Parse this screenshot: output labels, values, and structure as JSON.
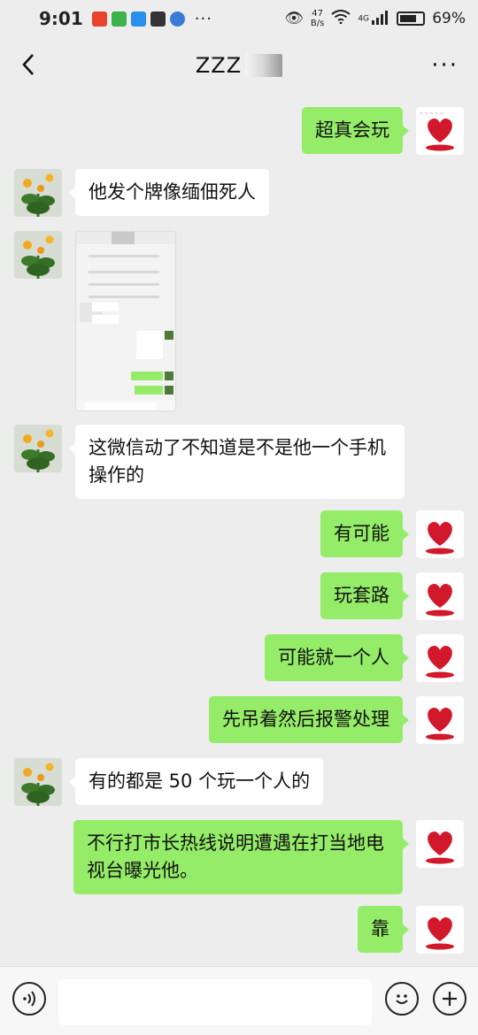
{
  "status": {
    "time": "9:01",
    "speed_value": "47",
    "speed_unit": "B/s",
    "network": "4G",
    "battery": "69%"
  },
  "header": {
    "title": "ZZZ"
  },
  "messages": [
    {
      "side": "out",
      "text": "超真会玩"
    },
    {
      "side": "in",
      "text": "他发个牌像缅佃死人"
    },
    {
      "side": "in",
      "type": "image"
    },
    {
      "side": "in",
      "text": "这微信动了不知道是不是他一个手机操作的"
    },
    {
      "side": "out",
      "text": "有可能"
    },
    {
      "side": "out",
      "text": "玩套路"
    },
    {
      "side": "out",
      "text": "可能就一个人"
    },
    {
      "side": "out",
      "text": "先吊着然后报警处理"
    },
    {
      "side": "in",
      "text": "有的都是 50 个玩一个人的"
    },
    {
      "side": "out",
      "text": "不行打市长热线说明遭遇在打当地电视台曝光他。"
    },
    {
      "side": "out",
      "text": "靠"
    }
  ],
  "colors": {
    "outgoing_bubble": "#95ec69",
    "incoming_bubble": "#ffffff",
    "background": "#ededed"
  }
}
